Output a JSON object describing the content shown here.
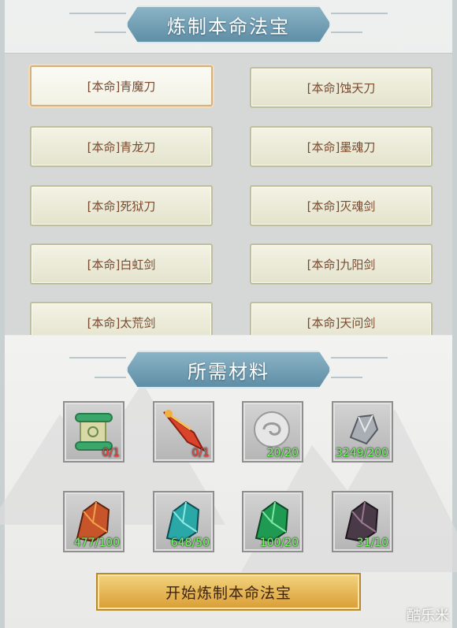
{
  "header": {
    "title": "炼制本命法宝"
  },
  "weapons": [
    "[本命]青魔刀",
    "[本命]蚀天刀",
    "[本命]青龙刀",
    "[本命]墨魂刀",
    "[本命]死狱刀",
    "[本命]灭魂剑",
    "[本命]白虹剑",
    "[本命]九阳剑",
    "[本命]太荒剑",
    "[本命]天问剑"
  ],
  "selected_weapon_index": 0,
  "materials": {
    "title": "所需材料",
    "items": [
      {
        "icon": "scroll-icon",
        "count": "0/1",
        "status": "insufficient"
      },
      {
        "icon": "blade-icon",
        "count": "0/1",
        "status": "insufficient"
      },
      {
        "icon": "silver-orb-icon",
        "count": "20/20",
        "status": "sufficient"
      },
      {
        "icon": "iron-ore-icon",
        "count": "3249/200",
        "status": "sufficient"
      },
      {
        "icon": "fire-crystal-icon",
        "count": "477/100",
        "status": "sufficient"
      },
      {
        "icon": "cyan-crystal-icon",
        "count": "648/50",
        "status": "sufficient"
      },
      {
        "icon": "green-crystal-icon",
        "count": "100/20",
        "status": "sufficient"
      },
      {
        "icon": "dark-crystal-icon",
        "count": "31/10",
        "status": "sufficient"
      }
    ]
  },
  "action": {
    "start_label": "开始炼制本命法宝"
  },
  "watermark": "酷乐米",
  "colors": {
    "insufficient": "#ff3b2f",
    "sufficient": "#6cff5a",
    "banner": "#6f9bb0"
  }
}
